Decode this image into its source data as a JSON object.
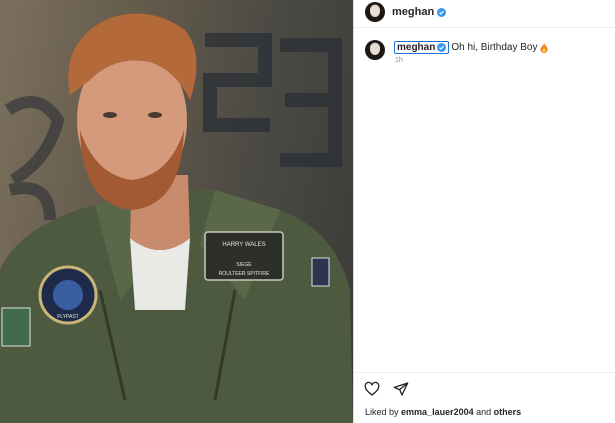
{
  "post": {
    "username": "meghan",
    "verified": true,
    "photo_patches": {
      "name_tag_line1": "HARRY WALES",
      "name_tag_line2": "SIEGE",
      "name_tag_line3": "ROULTEER SPITFIRE",
      "round_patch_text": "FLYPAST"
    },
    "comment": {
      "mention": "meghan",
      "text": "Oh hi, Birthday Boy",
      "emoji_icon": "fire-emoji",
      "time": "1h"
    },
    "actions": {
      "like_icon": "heart-icon",
      "share_icon": "paper-plane-icon"
    },
    "likes": {
      "prefix": "Liked by",
      "user": "emma_lauer2004",
      "and": "and",
      "others": "others"
    }
  },
  "colors": {
    "verified": "#3897f0",
    "mention_border": "#1f6fd6",
    "flight_suit": "#4e5a3f",
    "hair": "#b4693a"
  }
}
